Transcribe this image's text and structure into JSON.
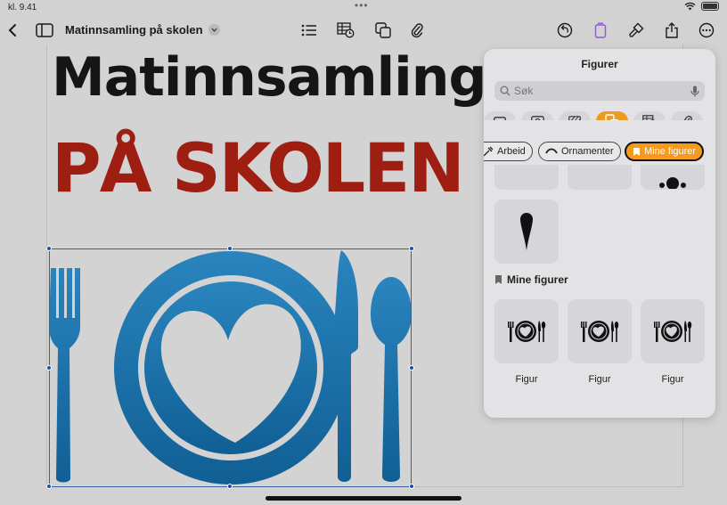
{
  "status": {
    "time": "kl. 9.41"
  },
  "document": {
    "title": "Matinnsamling på skolen",
    "heading_line1": "Matinnsamling",
    "heading_line2": "PÅ SKOLEN"
  },
  "popover": {
    "title": "Figurer",
    "search_placeholder": "Søk",
    "categories": [
      "image-icon",
      "media-icon",
      "texture-icon",
      "shapes-icon",
      "table-chart-icon",
      "attachment-icon"
    ],
    "active_category": 3,
    "chips": [
      {
        "label": "Arbeid",
        "icon": "tools-icon"
      },
      {
        "label": "Ornamenter",
        "icon": "ornament-icon"
      },
      {
        "label": "Mine figurer",
        "icon": "bookmark-icon",
        "active": true
      }
    ],
    "section_title": "Mine figurer",
    "figures": [
      {
        "label": "Figur"
      },
      {
        "label": "Figur"
      },
      {
        "label": "Figur"
      }
    ]
  },
  "colors": {
    "accent": "#ef9a20",
    "title_red": "#9e1f12",
    "shape_blue": "#1f71a8",
    "selection": "#1d4fa8"
  }
}
